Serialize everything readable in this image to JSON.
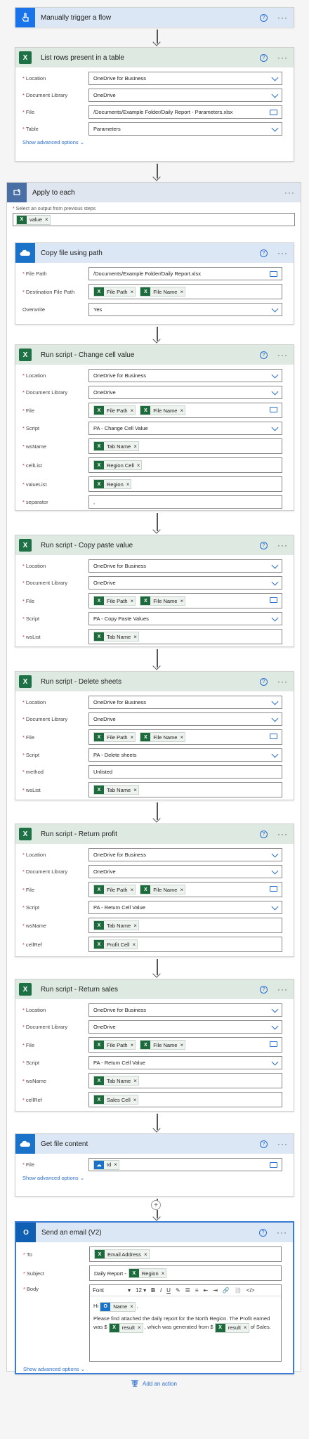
{
  "trigger": {
    "title": "Manually trigger a flow"
  },
  "list_rows": {
    "title": "List rows present in a table",
    "location_label": "Location",
    "location_value": "OneDrive for Business",
    "library_label": "Document Library",
    "library_value": "OneDrive",
    "file_label": "File",
    "file_value": "/Documents/Example Folder/Daily Report - Parameters.xlsx",
    "table_label": "Table",
    "table_value": "Parameters",
    "advanced": "Show advanced options"
  },
  "apply": {
    "title": "Apply to each",
    "select_label": "Select an output from previous steps",
    "token": "value"
  },
  "copy": {
    "title": "Copy file using path",
    "filepath_label": "File Path",
    "filepath_value": "/Documents/Example Folder/Daily Report.xlsx",
    "dest_label": "Destination File Path",
    "dest_tok1": "File Path",
    "dest_tok2": "File Name",
    "overwrite_label": "Overwrite",
    "overwrite_value": "Yes"
  },
  "script1": {
    "title": "Run script - Change cell value",
    "location_label": "Location",
    "location_value": "OneDrive for Business",
    "library_label": "Document Library",
    "library_value": "OneDrive",
    "file_label": "File",
    "file_tok1": "File Path",
    "file_tok2": "File Name",
    "script_label": "Script",
    "script_value": "PA - Change Cell Value",
    "p1_label": "wsName",
    "p1_tok": "Tab Name",
    "p2_label": "cellList",
    "p2_tok": "Region Cell",
    "p3_label": "valueList",
    "p3_tok": "Region",
    "p4_label": "separator",
    "p4_value": ","
  },
  "script2": {
    "title": "Run script - Copy paste value",
    "location_label": "Location",
    "location_value": "OneDrive for Business",
    "library_label": "Document Library",
    "library_value": "OneDrive",
    "file_label": "File",
    "file_tok1": "File Path",
    "file_tok2": "File Name",
    "script_label": "Script",
    "script_value": "PA - Copy Paste Values",
    "p1_label": "wsList",
    "p1_tok": "Tab Name"
  },
  "script3": {
    "title": "Run script - Delete sheets",
    "location_label": "Location",
    "location_value": "OneDrive for Business",
    "library_label": "Document Library",
    "library_value": "OneDrive",
    "file_label": "File",
    "file_tok1": "File Path",
    "file_tok2": "File Name",
    "script_label": "Script",
    "script_value": "PA - Delete sheets",
    "p1_label": "method",
    "p1_value": "Unlisted",
    "p2_label": "wsList",
    "p2_tok": "Tab Name"
  },
  "script4": {
    "title": "Run script - Return profit",
    "location_label": "Location",
    "location_value": "OneDrive for Business",
    "library_label": "Document Library",
    "library_value": "OneDrive",
    "file_label": "File",
    "file_tok1": "File Path",
    "file_tok2": "File Name",
    "script_label": "Script",
    "script_value": "PA - Return Cell Value",
    "p1_label": "wsName",
    "p1_tok": "Tab Name",
    "p2_label": "cellRef",
    "p2_tok": "Profit Cell"
  },
  "script5": {
    "title": "Run script - Return sales",
    "location_label": "Location",
    "location_value": "OneDrive for Business",
    "library_label": "Document Library",
    "library_value": "OneDrive",
    "file_label": "File",
    "file_tok1": "File Path",
    "file_tok2": "File Name",
    "script_label": "Script",
    "script_value": "PA - Return Cell Value",
    "p1_label": "wsName",
    "p1_tok": "Tab Name",
    "p2_label": "cellRef",
    "p2_tok": "Sales Cell"
  },
  "getfile": {
    "title": "Get file content",
    "file_label": "File",
    "file_tok": "Id",
    "advanced": "Show advanced options"
  },
  "email": {
    "title": "Send an email (V2)",
    "to_label": "To",
    "to_tok": "Email Address",
    "subject_label": "Subject",
    "subject_text": "Daily Report - ",
    "subject_tok": "Region",
    "body_label": "Body",
    "font": "Font",
    "size": "12",
    "hi": "Hi",
    "name_tok": "Name",
    "comma": ",",
    "line1": "Please find attached the daily report for the North Region.  The Profit earned was $",
    "result_tok": "result",
    "line2": ", which was generated from $",
    "line3": "of Sales.",
    "advanced": "Show advanced options"
  },
  "add_action": "Add an action",
  "colors": {
    "excel_green": "#1e7145",
    "accent_blue": "#2b6fd0",
    "required_red": "#d13438"
  }
}
